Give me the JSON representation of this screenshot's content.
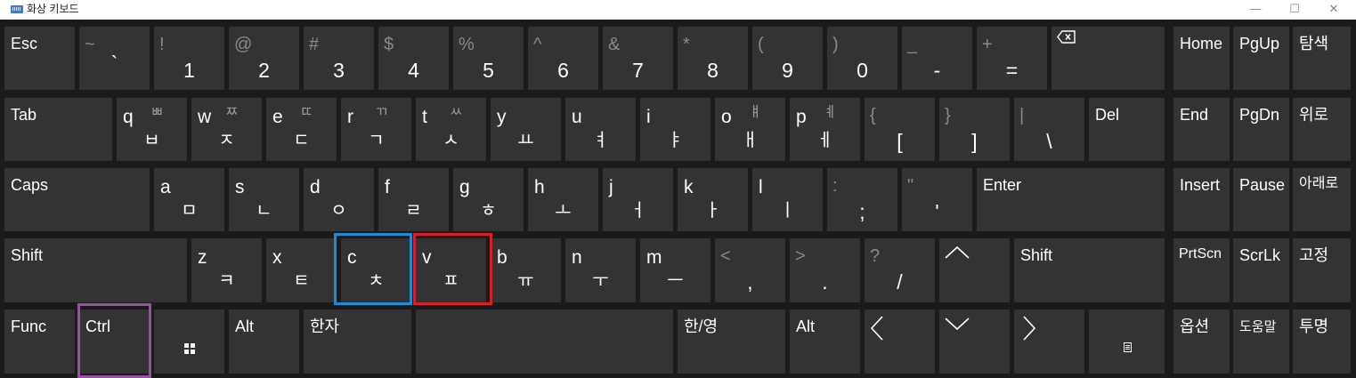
{
  "window": {
    "title": "화상 키보드",
    "minimize": "—",
    "maximize": "☐",
    "close": "✕"
  },
  "keys": {
    "esc": "Esc",
    "backquote": {
      "shift": "~",
      "main": "`"
    },
    "d1": {
      "shift": "!",
      "main": "1"
    },
    "d2": {
      "shift": "@",
      "main": "2"
    },
    "d3": {
      "shift": "#",
      "main": "3"
    },
    "d4": {
      "shift": "$",
      "main": "4"
    },
    "d5": {
      "shift": "%",
      "main": "5"
    },
    "d6": {
      "shift": "^",
      "main": "6"
    },
    "d7": {
      "shift": "&",
      "main": "7"
    },
    "d8": {
      "shift": "*",
      "main": "8"
    },
    "d9": {
      "shift": "(",
      "main": "9"
    },
    "d0": {
      "shift": ")",
      "main": "0"
    },
    "minus": {
      "shift": "_",
      "main": "-"
    },
    "equals": {
      "shift": "+",
      "main": "="
    },
    "home": "Home",
    "pgup": "PgUp",
    "navigate": "탐색",
    "tab": "Tab",
    "q": {
      "letter": "q",
      "hshift": "ㅃ",
      "hmain": "ㅂ"
    },
    "w": {
      "letter": "w",
      "hshift": "ㅉ",
      "hmain": "ㅈ"
    },
    "e": {
      "letter": "e",
      "hshift": "ㄸ",
      "hmain": "ㄷ"
    },
    "r": {
      "letter": "r",
      "hshift": "ㄲ",
      "hmain": "ㄱ"
    },
    "t": {
      "letter": "t",
      "hshift": "ㅆ",
      "hmain": "ㅅ"
    },
    "y": {
      "letter": "y",
      "hmain": "ㅛ"
    },
    "u": {
      "letter": "u",
      "hmain": "ㅕ"
    },
    "i": {
      "letter": "i",
      "hmain": "ㅑ"
    },
    "o": {
      "letter": "o",
      "hshift": "ㅒ",
      "hmain": "ㅐ"
    },
    "p": {
      "letter": "p",
      "hshift": "ㅖ",
      "hmain": "ㅔ"
    },
    "lbracket": {
      "shift": "{",
      "main": "["
    },
    "rbracket": {
      "shift": "}",
      "main": "]"
    },
    "backslash": {
      "shift": "|",
      "main": "\\"
    },
    "del": "Del",
    "end": "End",
    "pgdn": "PgDn",
    "up_label": "위로",
    "caps": "Caps",
    "a": {
      "letter": "a",
      "hmain": "ㅁ"
    },
    "s": {
      "letter": "s",
      "hmain": "ㄴ"
    },
    "d": {
      "letter": "d",
      "hmain": "ㅇ"
    },
    "f": {
      "letter": "f",
      "hmain": "ㄹ"
    },
    "g": {
      "letter": "g",
      "hmain": "ㅎ"
    },
    "h": {
      "letter": "h",
      "hmain": "ㅗ"
    },
    "j": {
      "letter": "j",
      "hmain": "ㅓ"
    },
    "k": {
      "letter": "k",
      "hmain": "ㅏ"
    },
    "l": {
      "letter": "l",
      "hmain": "ㅣ"
    },
    "semicolon": {
      "shift": ":",
      "main": ";"
    },
    "quote": {
      "shift": "\"",
      "main": "'"
    },
    "enter": "Enter",
    "insert": "Insert",
    "pause": "Pause",
    "down_label": "아래로",
    "shift_left": "Shift",
    "z": {
      "letter": "z",
      "hmain": "ㅋ"
    },
    "x": {
      "letter": "x",
      "hmain": "ㅌ"
    },
    "c": {
      "letter": "c",
      "hmain": "ㅊ"
    },
    "v": {
      "letter": "v",
      "hmain": "ㅍ"
    },
    "b": {
      "letter": "b",
      "hmain": "ㅠ"
    },
    "n": {
      "letter": "n",
      "hmain": "ㅜ"
    },
    "m": {
      "letter": "m",
      "hmain": "ㅡ"
    },
    "comma": {
      "shift": "<",
      "main": ","
    },
    "period": {
      "shift": ">",
      "main": "."
    },
    "slash": {
      "shift": "?",
      "main": "/"
    },
    "shift_right": "Shift",
    "prtscn": "PrtScn",
    "scrlk": "ScrLk",
    "dock": "고정",
    "func": "Func",
    "ctrl": "Ctrl",
    "alt_left": "Alt",
    "hanja": "한자",
    "hanyeong": "한/영",
    "alt_right": "Alt",
    "options": "옵션",
    "help": "도움말",
    "fade": "투명"
  },
  "highlights": {
    "ctrl": "#9b4fa6",
    "c": "#1a8fd6",
    "v": "#d9202a"
  },
  "colors": {
    "board": "#1b1b1b",
    "key": "#333333"
  }
}
